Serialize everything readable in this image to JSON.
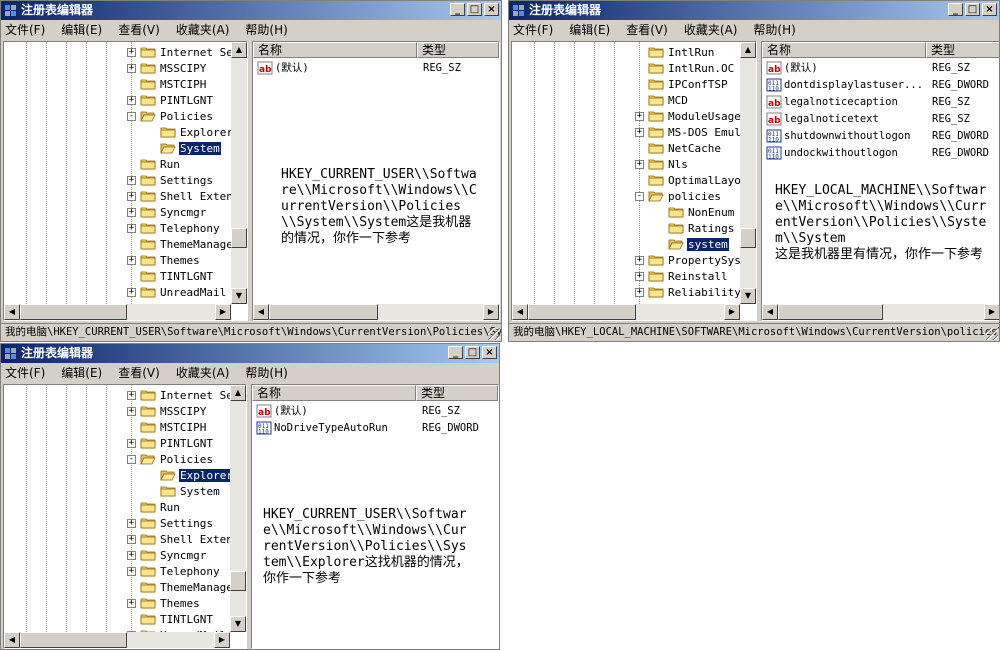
{
  "colors": {
    "selection": "#0a246a",
    "chrome": "#d4d0c8",
    "folder": "#ffd86b"
  },
  "title": "注册表编辑器",
  "menu": [
    "文件(F)",
    "编辑(E)",
    "查看(V)",
    "收藏夹(A)",
    "帮助(H)"
  ],
  "columns": {
    "name": "名称",
    "type": "类型"
  },
  "win1": {
    "tree": [
      {
        "label": "Internet Se",
        "exp": "+"
      },
      {
        "label": "MSSCIPY",
        "exp": "+"
      },
      {
        "label": "MSTCIPH",
        "exp": ""
      },
      {
        "label": "PINTLGNT",
        "exp": "+"
      },
      {
        "label": "Policies",
        "exp": "-"
      },
      {
        "label": "Explorer",
        "exp": "",
        "child": true
      },
      {
        "label": "System",
        "exp": "",
        "child": true,
        "sel": true
      },
      {
        "label": "Run",
        "exp": ""
      },
      {
        "label": "Settings",
        "exp": "+"
      },
      {
        "label": "Shell Exten",
        "exp": "+"
      },
      {
        "label": "Syncmgr",
        "exp": "+"
      },
      {
        "label": "Telephony",
        "exp": "+"
      },
      {
        "label": "ThemeManage",
        "exp": ""
      },
      {
        "label": "Themes",
        "exp": "+"
      },
      {
        "label": "TINTLGNT",
        "exp": ""
      },
      {
        "label": "UnreadMail",
        "exp": "+"
      }
    ],
    "values": [
      {
        "name": "(默认)",
        "type": "REG_SZ",
        "icon": "string"
      }
    ],
    "note": "HKEY_CURRENT_USER\\\\Software\\\\Microsoft\\\\Windows\\\\CurrentVersion\\\\Policies\\\\System\\\\System这是我机器的情况，你作一下参考",
    "status": "我的电脑\\HKEY_CURRENT_USER\\Software\\Microsoft\\Windows\\CurrentVersion\\Policies\\Sy"
  },
  "win2": {
    "tree": [
      {
        "label": "IntlRun",
        "exp": ""
      },
      {
        "label": "IntlRun.OC",
        "exp": ""
      },
      {
        "label": "IPConfTSP",
        "exp": ""
      },
      {
        "label": "MCD",
        "exp": ""
      },
      {
        "label": "ModuleUsage",
        "exp": "+"
      },
      {
        "label": "MS-DOS Emul",
        "exp": "+"
      },
      {
        "label": "NetCache",
        "exp": ""
      },
      {
        "label": "Nls",
        "exp": "+"
      },
      {
        "label": "OptimalLayo",
        "exp": ""
      },
      {
        "label": "policies",
        "exp": "-"
      },
      {
        "label": "NonEnum",
        "exp": "",
        "child": true
      },
      {
        "label": "Ratings",
        "exp": "",
        "child": true
      },
      {
        "label": "system",
        "exp": "",
        "child": true,
        "sel": true
      },
      {
        "label": "PropertySys",
        "exp": "+"
      },
      {
        "label": "Reinstall",
        "exp": "+"
      },
      {
        "label": "Reliability",
        "exp": "+"
      }
    ],
    "values": [
      {
        "name": "(默认)",
        "type": "REG_SZ",
        "icon": "string"
      },
      {
        "name": "dontdisplaylastuser...",
        "type": "REG_DWORD",
        "icon": "binary"
      },
      {
        "name": "legalnoticecaption",
        "type": "REG_SZ",
        "icon": "string"
      },
      {
        "name": "legalnoticetext",
        "type": "REG_SZ",
        "icon": "string"
      },
      {
        "name": "shutdownwithoutlogon",
        "type": "REG_DWORD",
        "icon": "binary"
      },
      {
        "name": "undockwithoutlogon",
        "type": "REG_DWORD",
        "icon": "binary"
      }
    ],
    "note": "HKEY_LOCAL_MACHINE\\\\Software\\\\Microsoft\\\\Windows\\\\CurrentVersion\\\\Policies\\\\System\\\\System",
    "note2": "这是我机器里有情况，你作一下参考",
    "status": "我的电脑\\HKEY_LOCAL_MACHINE\\SOFTWARE\\Microsoft\\Windows\\CurrentVersion\\policies\\s;"
  },
  "win3": {
    "tree": [
      {
        "label": "Internet Se",
        "exp": "+"
      },
      {
        "label": "MSSCIPY",
        "exp": "+"
      },
      {
        "label": "MSTCIPH",
        "exp": ""
      },
      {
        "label": "PINTLGNT",
        "exp": "+"
      },
      {
        "label": "Policies",
        "exp": "-"
      },
      {
        "label": "Explorer",
        "exp": "",
        "child": true,
        "sel": true
      },
      {
        "label": "System",
        "exp": "",
        "child": true
      },
      {
        "label": "Run",
        "exp": ""
      },
      {
        "label": "Settings",
        "exp": "+"
      },
      {
        "label": "Shell Exten",
        "exp": "+"
      },
      {
        "label": "Syncmgr",
        "exp": "+"
      },
      {
        "label": "Telephony",
        "exp": "+"
      },
      {
        "label": "ThemeManage",
        "exp": ""
      },
      {
        "label": "Themes",
        "exp": "+"
      },
      {
        "label": "TINTLGNT",
        "exp": ""
      },
      {
        "label": "UnreadMail",
        "exp": "+"
      }
    ],
    "values": [
      {
        "name": "(默认)",
        "type": "REG_SZ",
        "icon": "string"
      },
      {
        "name": "NoDriveTypeAutoRun",
        "type": "REG_DWORD",
        "icon": "binary"
      }
    ],
    "note": "HKEY_CURRENT_USER\\\\Software\\\\Microsoft\\\\Windows\\\\CurrentVersion\\\\Policies\\\\System\\\\Explorer这找机器的情况，你作一下参考"
  }
}
